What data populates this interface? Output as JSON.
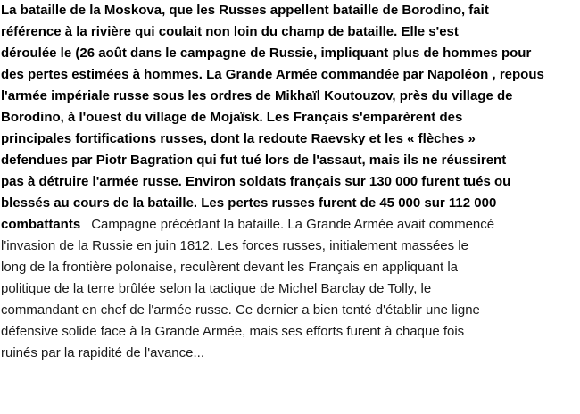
{
  "bold_lines": [
    "La bataille de la Moskova, que les Russes appellent bataille de Borodino, fait",
    "référence à la rivière qui coulait non loin du champ de bataille. Elle s'est",
    "déroulée le  (26 août dans le campagne de Russie, impliquant plus de  hommes pour",
    "des pertes estimées à  hommes. La Grande Armée commandée par Napoléon , repous",
    "l'armée impériale russe sous les ordres de Mikhaïl Koutouzov, près du village de",
    "Borodino, à l'ouest du village de Mojaïsk. Les Français s'emparèrent des",
    "principales fortifications russes, dont la redoute Raevsky et les « flèches »",
    "defendues par Piotr Bagration qui fut tué lors de l'assaut, mais ils ne réussirent",
    "pas à détruire l'armée russe. Environ  soldats français sur 130 000 furent tués ou",
    "blessés au cours de la bataille. Les pertes russes furent de 45 000 sur 112 000"
  ],
  "mixed_line": {
    "bold": "combattants",
    "regular": "Campagne précédant la bataille.  La Grande Armée avait commencé"
  },
  "regular_lines": [
    "l'invasion de la Russie en juin 1812. Les forces russes, initialement massées le",
    "long de la frontière polonaise, reculèrent devant les Français en appliquant la",
    "politique de la terre brûlée selon la tactique de Michel Barclay de Tolly, le",
    "commandant en chef de l'armée russe. Ce dernier a bien tenté d'établir une ligne",
    "défensive solide face à la Grande Armée, mais ses efforts furent à chaque fois",
    "ruinés par la rapidité de l'avance..."
  ]
}
